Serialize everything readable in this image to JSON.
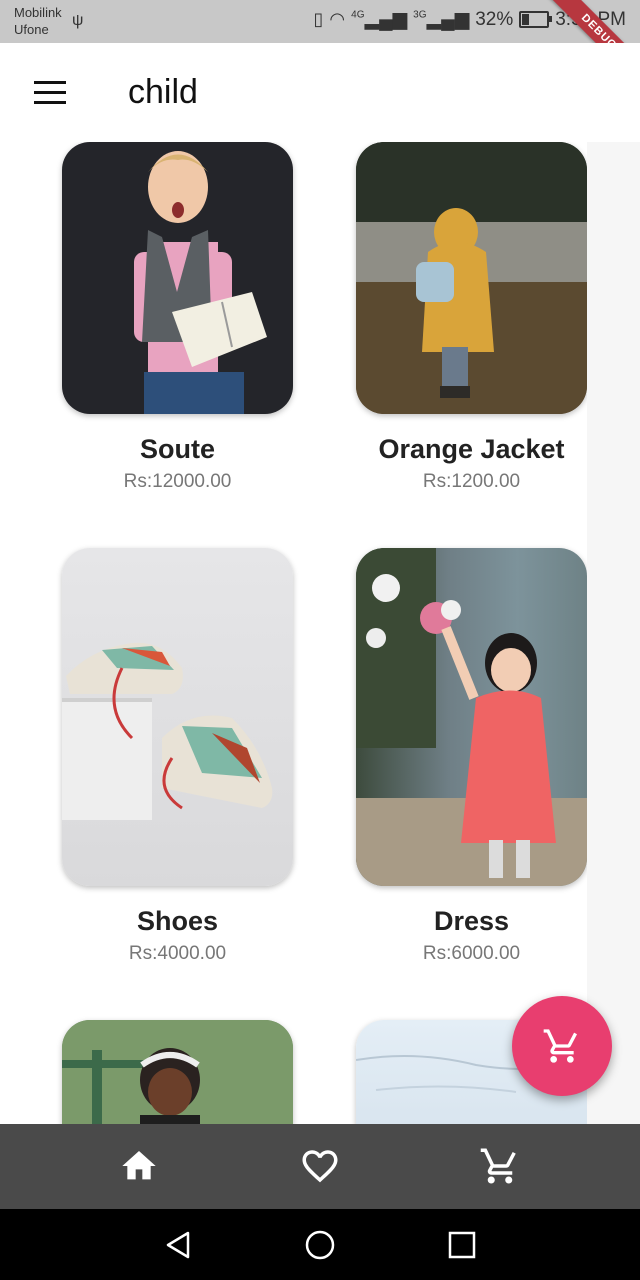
{
  "status_bar": {
    "carrier_1": "Mobilink",
    "carrier_2": "Ufone",
    "net_1": "4G",
    "net_2": "3G",
    "battery": "32%",
    "battery_level": 0.32,
    "time": "3:56 PM"
  },
  "debug_banner": "DEBUG",
  "app_bar": {
    "title": "child"
  },
  "products": [
    {
      "name": "Soute",
      "price": "Rs:12000.00"
    },
    {
      "name": "Orange Jacket",
      "price": "Rs:1200.00"
    },
    {
      "name": "Shoes",
      "price": "Rs:4000.00"
    },
    {
      "name": "Dress",
      "price": "Rs:6000.00"
    }
  ],
  "colors": {
    "fab": "#e83e6f",
    "bottom_nav": "#4a4a4a",
    "status_bar": "#c8c8c8",
    "debug": "#b7373f"
  },
  "icons": {
    "menu": "menu-icon",
    "fab": "cart-icon",
    "nav_home": "home-icon",
    "nav_favorite": "heart-icon",
    "nav_cart": "cart-icon",
    "sys_back": "back-icon",
    "sys_home": "circle-icon",
    "sys_recent": "square-icon"
  }
}
